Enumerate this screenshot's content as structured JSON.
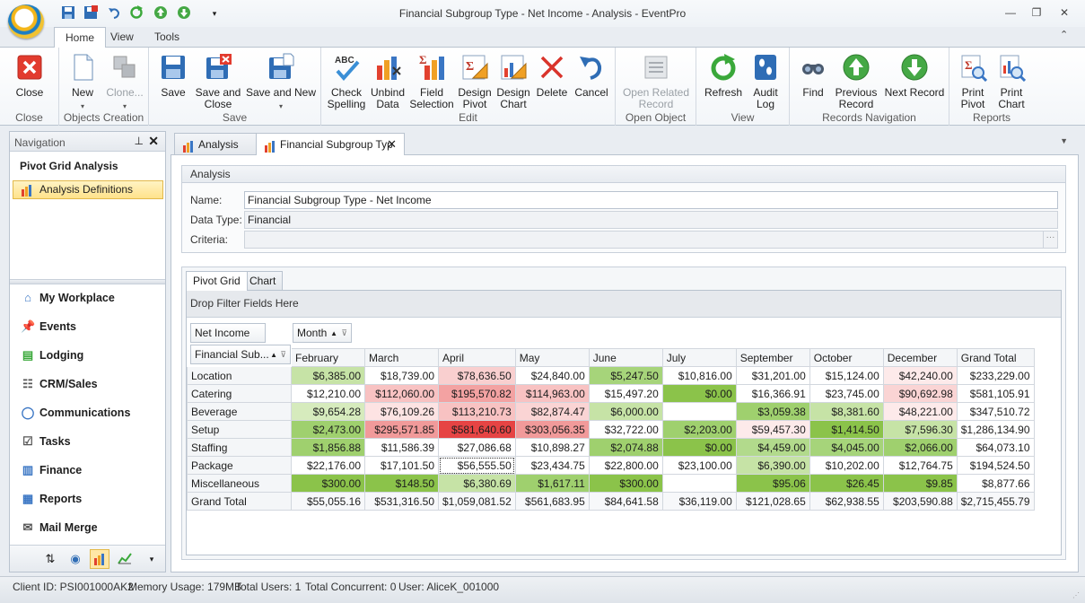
{
  "window": {
    "title": "Financial Subgroup Type - Net Income - Analysis - EventPro",
    "minimize": "—",
    "restore": "❐",
    "close": "✕",
    "ribbon_collapse": "⌃"
  },
  "ribbon_tabs": [
    "Home",
    "View",
    "Tools"
  ],
  "ribbon": {
    "groups": {
      "close": "Close",
      "objects_creation": "Objects Creation",
      "save": "Save",
      "edit": "Edit",
      "open_object": "Open Object",
      "view": "View",
      "records_navigation": "Records Navigation",
      "reports": "Reports"
    },
    "buttons": {
      "close": "Close",
      "new": "New",
      "clone": "Clone...",
      "save": "Save",
      "save_and_close_1": "Save and",
      "save_and_close_2": "Close",
      "save_and_new": "Save and New",
      "check_spelling_1": "Check",
      "check_spelling_2": "Spelling",
      "unbind_data_1": "Unbind",
      "unbind_data_2": "Data",
      "field_selection_1": "Field",
      "field_selection_2": "Selection",
      "design_pivot_1": "Design",
      "design_pivot_2": "Pivot",
      "design_chart_1": "Design",
      "design_chart_2": "Chart",
      "delete": "Delete",
      "cancel": "Cancel",
      "open_related_1": "Open Related",
      "open_related_2": "Record",
      "refresh": "Refresh",
      "audit_log_1": "Audit",
      "audit_log_2": "Log",
      "find": "Find",
      "previous_record_1": "Previous",
      "previous_record_2": "Record",
      "next_record": "Next Record",
      "print_pivot_1": "Print",
      "print_pivot_2": "Pivot",
      "print_chart_1": "Print",
      "print_chart_2": "Chart"
    },
    "abc_label": "ABC"
  },
  "navigation": {
    "header": "Navigation",
    "group_title": "Pivot Grid Analysis",
    "selected_item": "Analysis Definitions",
    "items": [
      "My Workplace",
      "Events",
      "Lodging",
      "CRM/Sales",
      "Communications",
      "Tasks",
      "Finance",
      "Reports",
      "Mail Merge"
    ]
  },
  "doc_tabs": [
    "Analysis",
    "Financial Subgroup Typ"
  ],
  "analysis": {
    "header": "Analysis",
    "name_label": "Name:",
    "name_value": "Financial Subgroup Type - Net Income",
    "datatype_label": "Data Type:",
    "datatype_value": "Financial",
    "criteria_label": "Criteria:",
    "criteria_value": "",
    "criteria_btn": "···"
  },
  "inner_tabs": [
    "Pivot Grid",
    "Chart"
  ],
  "pivot": {
    "filter_area": "Drop Filter Fields Here",
    "data_field": "Net Income",
    "column_field": "Month",
    "row_field": "Financial Sub...",
    "columns": [
      "February",
      "March",
      "April",
      "May",
      "June",
      "July",
      "September",
      "October",
      "December",
      "Grand Total"
    ],
    "rows": [
      {
        "label": "Location",
        "values": [
          "$6,385.00",
          "$18,739.00",
          "$78,636.50",
          "$24,840.00",
          "$5,247.50",
          "$10,816.00",
          "$31,201.00",
          "$15,124.00",
          "$42,240.00",
          "$233,229.00"
        ],
        "colors": [
          "#c6e3a6",
          "#ffffff",
          "#f9cfcf",
          "#ffffff",
          "#a6d47a",
          "#ffffff",
          "#ffffff",
          "#ffffff",
          "#fdeaea",
          "#ffffff"
        ]
      },
      {
        "label": "Catering",
        "values": [
          "$12,210.00",
          "$112,060.00",
          "$195,570.82",
          "$114,963.00",
          "$15,497.20",
          "$0.00",
          "$16,366.91",
          "$23,745.00",
          "$90,692.98",
          "$581,105.91"
        ],
        "colors": [
          "#ffffff",
          "#f8c2c2",
          "#f3a2a2",
          "#f8c2c2",
          "#ffffff",
          "#8bc34a",
          "#ffffff",
          "#ffffff",
          "#fad4d4",
          "#ffffff"
        ]
      },
      {
        "label": "Beverage",
        "values": [
          "$9,654.28",
          "$76,109.26",
          "$113,210.73",
          "$82,874.47",
          "$6,000.00",
          "",
          "$3,059.38",
          "$8,381.60",
          "$48,221.00",
          "$347,510.72"
        ],
        "colors": [
          "#d6ebbd",
          "#fde3e3",
          "#f8c2c2",
          "#fad4d4",
          "#c6e3a6",
          "#ffffff",
          "#9fd06e",
          "#c6e3a6",
          "#fdeaea",
          "#ffffff"
        ]
      },
      {
        "label": "Setup",
        "values": [
          "$2,473.00",
          "$295,571.85",
          "$581,640.60",
          "$303,056.35",
          "$32,722.00",
          "$2,203.00",
          "$59,457.30",
          "$1,414.50",
          "$7,596.30",
          "$1,286,134.90"
        ],
        "colors": [
          "#9fd06e",
          "#f19a9a",
          "#e64444",
          "#f19a9a",
          "#ffffff",
          "#9fd06e",
          "#fdeaea",
          "#8bc34a",
          "#c6e3a6",
          "#ffffff"
        ]
      },
      {
        "label": "Staffing",
        "values": [
          "$1,856.88",
          "$11,586.39",
          "$27,086.68",
          "$10,898.27",
          "$2,074.88",
          "$0.00",
          "$4,459.00",
          "$4,045.00",
          "$2,066.00",
          "$64,073.10"
        ],
        "colors": [
          "#9fd06e",
          "#ffffff",
          "#ffffff",
          "#ffffff",
          "#9fd06e",
          "#8bc34a",
          "#b2da8c",
          "#a6d47a",
          "#9fd06e",
          "#ffffff"
        ]
      },
      {
        "label": "Package",
        "values": [
          "$22,176.00",
          "$17,101.50",
          "$56,555.50",
          "$23,434.75",
          "$22,800.00",
          "$23,100.00",
          "$6,390.00",
          "$10,202.00",
          "$12,764.75",
          "$194,524.50"
        ],
        "colors": [
          "#ffffff",
          "#ffffff",
          "#ffffff",
          "#ffffff",
          "#ffffff",
          "#ffffff",
          "#c6e3a6",
          "#ffffff",
          "#ffffff",
          "#ffffff"
        ]
      },
      {
        "label": "Miscellaneous",
        "values": [
          "$300.00",
          "$148.50",
          "$6,380.69",
          "$1,617.11",
          "$300.00",
          "",
          "$95.06",
          "$26.45",
          "$9.85",
          "$8,877.66"
        ],
        "colors": [
          "#8bc34a",
          "#8bc34a",
          "#c6e3a6",
          "#9fd06e",
          "#8bc34a",
          "#ffffff",
          "#8bc34a",
          "#8bc34a",
          "#8bc34a",
          "#ffffff"
        ]
      }
    ],
    "grand_total": {
      "label": "Grand Total",
      "values": [
        "$55,055.16",
        "$531,316.50",
        "$1,059,081.52",
        "$561,683.95",
        "$84,641.58",
        "$36,119.00",
        "$121,028.65",
        "$62,938.55",
        "$203,590.88",
        "$2,715,455.79"
      ]
    }
  },
  "status": {
    "client_id": "Client ID: PSI001000AK2",
    "memory": "Memory Usage: 179MB",
    "total_users": "Total Users: 1",
    "total_concurrent": "Total Concurrent: 0",
    "user": "User: AliceK_001000"
  }
}
